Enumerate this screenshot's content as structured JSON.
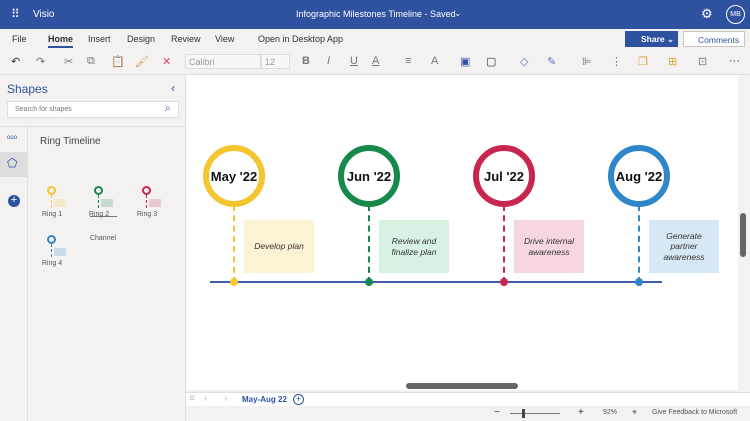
{
  "app": {
    "name": "Visio",
    "doc_title": "Infographic Milestones Timeline - Saved",
    "avatar": "MB"
  },
  "menu": [
    "File",
    "Home",
    "Insert",
    "Design",
    "Review",
    "View",
    "Open in Desktop App"
  ],
  "share_label": "Share",
  "comments_label": "Comments",
  "toolbar": {
    "font": "Calibri",
    "size": "12",
    "bold": "B",
    "italic": "I",
    "underline": "U",
    "font_color": "A",
    "more": "···"
  },
  "sidebar": {
    "title": "Shapes",
    "search_placeholder": "Search for shapes",
    "stencil": "Ring Timeline",
    "shapes": [
      "Ring 1",
      "Ring 2",
      "Ring 3",
      "Ring 4",
      "Channel"
    ]
  },
  "milestones": [
    {
      "label": "May '22",
      "task": "Develop plan",
      "color": "#f2c531",
      "fill": "#fcf3d4"
    },
    {
      "label": "Jun '22",
      "task": "Review and finalize plan",
      "color": "#17894a",
      "fill": "#d7f2e2"
    },
    {
      "label": "Jul '22",
      "task": "Drive internal awareness",
      "color": "#c8264f",
      "fill": "#f6d7e0"
    },
    {
      "label": "Aug '22",
      "task": "Generate partner awareness",
      "color": "#2f87c9",
      "fill": "#d7e7f4"
    }
  ],
  "timeline_color": "#3e5fb0",
  "page_tab": "May-Aug 22",
  "status": {
    "zoom": "92%",
    "feedback": "Give Feedback to Microsoft",
    "zoom_fraction": 0.23
  }
}
